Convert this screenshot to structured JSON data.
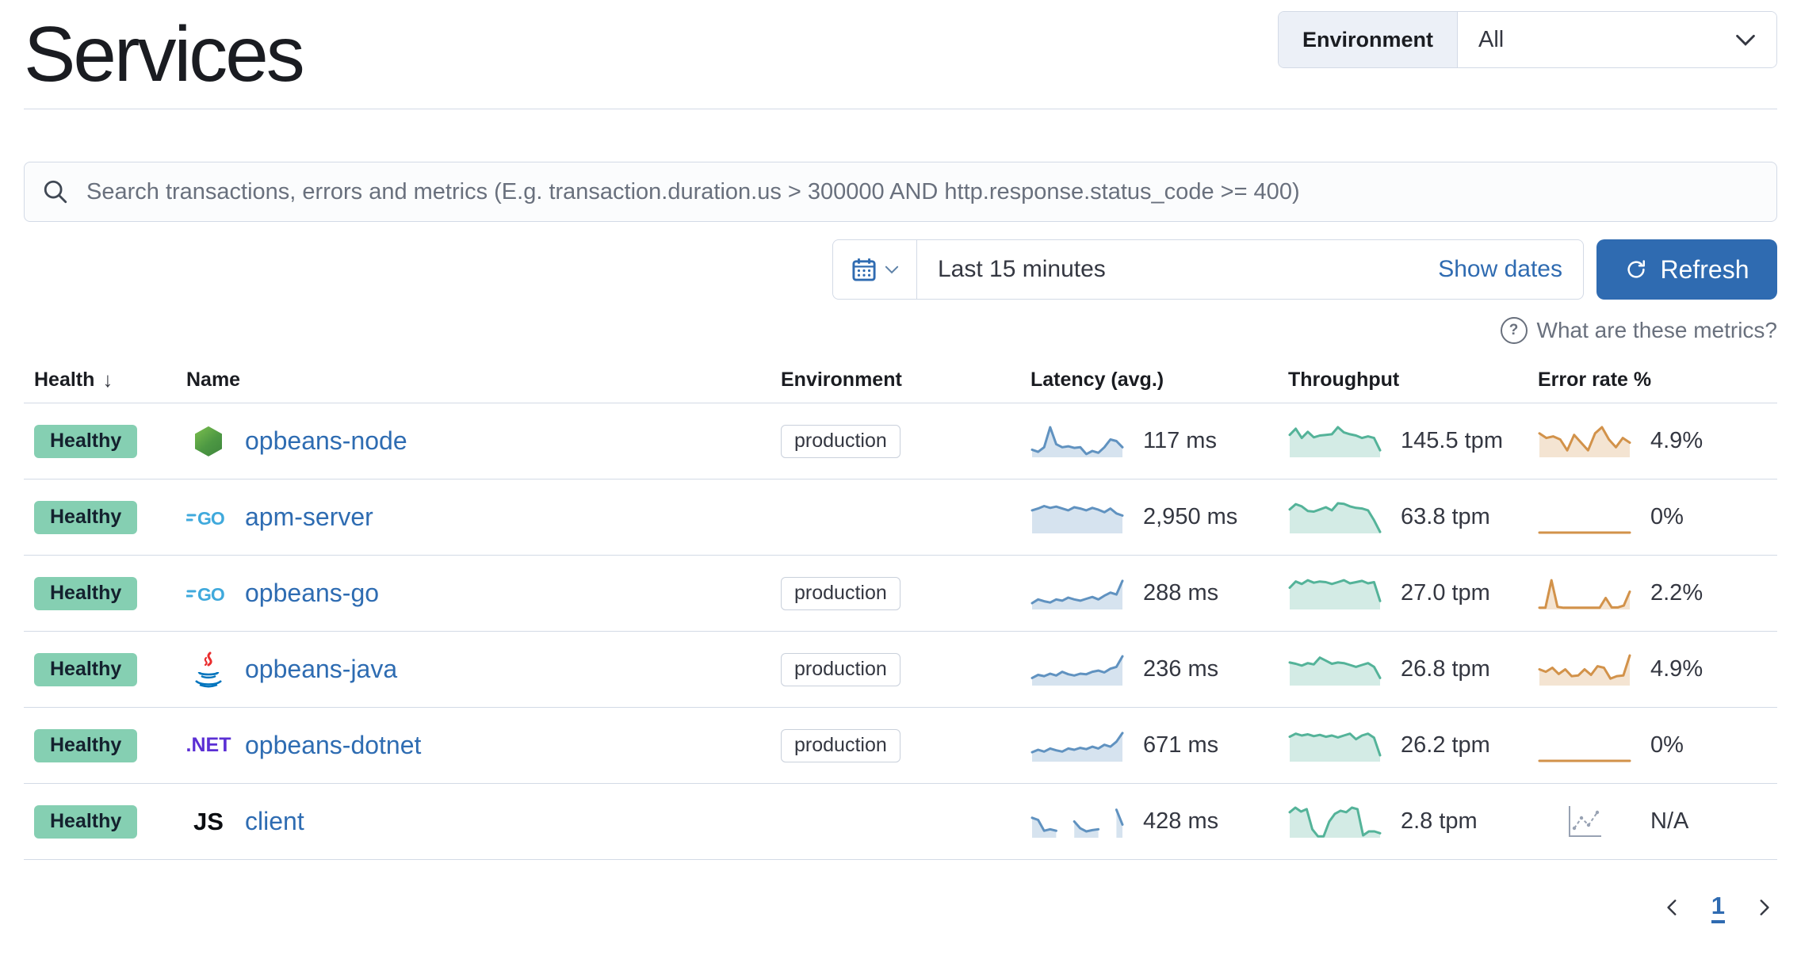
{
  "page": {
    "title": "Services"
  },
  "env_filter": {
    "label": "Environment",
    "value": "All"
  },
  "search": {
    "placeholder": "Search transactions, errors and metrics (E.g. transaction.duration.us > 300000 AND http.response.status_code >= 400)"
  },
  "time_picker": {
    "value": "Last 15 minutes",
    "show_dates_label": "Show dates",
    "refresh_label": "Refresh"
  },
  "metrics_help": {
    "label": "What are these metrics?"
  },
  "table": {
    "columns": [
      "Health",
      "Name",
      "Environment",
      "Latency (avg.)",
      "Throughput",
      "Error rate %"
    ],
    "sorted_column": "Health",
    "agent_icon_labels": {
      "go": "GO",
      "dotnet": ".NET",
      "js": "JS"
    },
    "rows": [
      {
        "health": "Healthy",
        "name": "opbeans-node",
        "agent": "nodejs",
        "environment": "production",
        "latency": {
          "value": "117 ms",
          "points": [
            0.22,
            0.15,
            0.3,
            0.95,
            0.4,
            0.3,
            0.33,
            0.28,
            0.3,
            0.08,
            0.18,
            0.12,
            0.3,
            0.55,
            0.5,
            0.3
          ]
        },
        "throughput": {
          "value": "145.5 tpm",
          "points": [
            0.7,
            0.9,
            0.6,
            0.8,
            0.62,
            0.68,
            0.7,
            0.72,
            0.95,
            0.78,
            0.72,
            0.68,
            0.6,
            0.65,
            0.6,
            0.2
          ]
        },
        "error_rate": {
          "value": "4.9%",
          "points": [
            0.75,
            0.6,
            0.65,
            0.55,
            0.2,
            0.7,
            0.45,
            0.2,
            0.75,
            0.95,
            0.55,
            0.3,
            0.6,
            0.45
          ]
        }
      },
      {
        "health": "Healthy",
        "name": "apm-server",
        "agent": "go",
        "environment": "",
        "latency": {
          "value": "2,950 ms",
          "points": [
            0.72,
            0.78,
            0.86,
            0.8,
            0.84,
            0.78,
            0.72,
            0.82,
            0.78,
            0.72,
            0.8,
            0.74,
            0.66,
            0.78,
            0.62,
            0.55
          ]
        },
        "throughput": {
          "value": "63.8 tpm",
          "points": [
            0.75,
            0.92,
            0.85,
            0.7,
            0.68,
            0.75,
            0.82,
            0.72,
            0.95,
            0.93,
            0.85,
            0.8,
            0.78,
            0.72,
            0.4,
            0.02
          ]
        },
        "error_rate": {
          "value": "0%",
          "points": [
            0,
            0,
            0,
            0,
            0,
            0,
            0,
            0,
            0,
            0,
            0,
            0,
            0,
            0,
            0,
            0
          ]
        }
      },
      {
        "health": "Healthy",
        "name": "opbeans-go",
        "agent": "go",
        "environment": "production",
        "latency": {
          "value": "288 ms",
          "points": [
            0.18,
            0.3,
            0.24,
            0.2,
            0.3,
            0.26,
            0.36,
            0.3,
            0.26,
            0.32,
            0.38,
            0.3,
            0.42,
            0.52,
            0.46,
            0.9
          ]
        },
        "throughput": {
          "value": "27.0 tpm",
          "points": [
            0.68,
            0.88,
            0.8,
            0.92,
            0.84,
            0.88,
            0.86,
            0.8,
            0.86,
            0.92,
            0.82,
            0.86,
            0.9,
            0.82,
            0.86,
            0.25
          ]
        },
        "error_rate": {
          "value": "2.2%",
          "points": [
            0.03,
            0.03,
            0.92,
            0.06,
            0.03,
            0.03,
            0.03,
            0.03,
            0.03,
            0.03,
            0.03,
            0.35,
            0.04,
            0.04,
            0.1,
            0.55
          ]
        }
      },
      {
        "health": "Healthy",
        "name": "opbeans-java",
        "agent": "java",
        "environment": "production",
        "latency": {
          "value": "236 ms",
          "points": [
            0.22,
            0.32,
            0.28,
            0.36,
            0.3,
            0.42,
            0.34,
            0.3,
            0.36,
            0.34,
            0.42,
            0.46,
            0.4,
            0.52,
            0.58,
            0.92
          ]
        },
        "throughput": {
          "value": "26.8 tpm",
          "points": [
            0.72,
            0.68,
            0.62,
            0.7,
            0.66,
            0.88,
            0.78,
            0.68,
            0.72,
            0.7,
            0.64,
            0.58,
            0.64,
            0.7,
            0.58,
            0.22
          ]
        },
        "error_rate": {
          "value": "4.9%",
          "points": [
            0.5,
            0.42,
            0.55,
            0.35,
            0.5,
            0.28,
            0.3,
            0.5,
            0.32,
            0.6,
            0.55,
            0.2,
            0.28,
            0.3,
            0.95
          ]
        }
      },
      {
        "health": "Healthy",
        "name": "opbeans-dotnet",
        "agent": "dotnet",
        "environment": "production",
        "latency": {
          "value": "671 ms",
          "points": [
            0.28,
            0.36,
            0.3,
            0.4,
            0.34,
            0.3,
            0.4,
            0.36,
            0.42,
            0.38,
            0.46,
            0.4,
            0.52,
            0.46,
            0.62,
            0.9
          ]
        },
        "throughput": {
          "value": "26.2 tpm",
          "points": [
            0.78,
            0.88,
            0.82,
            0.86,
            0.8,
            0.84,
            0.78,
            0.82,
            0.76,
            0.82,
            0.88,
            0.7,
            0.82,
            0.88,
            0.75,
            0.18
          ]
        },
        "error_rate": {
          "value": "0%",
          "points": [
            0,
            0,
            0,
            0,
            0,
            0,
            0,
            0,
            0,
            0,
            0,
            0,
            0,
            0,
            0,
            0
          ]
        }
      },
      {
        "health": "Healthy",
        "name": "client",
        "agent": "js",
        "environment": "",
        "latency": {
          "value": "428 ms",
          "points": [
            0.62,
            0.55,
            0.2,
            0.25,
            0.2,
            null,
            null,
            0.5,
            0.28,
            0.18,
            0.22,
            0.25,
            null,
            null,
            0.88,
            0.4
          ]
        },
        "throughput": {
          "value": "2.8 tpm",
          "points": [
            0.8,
            0.95,
            0.82,
            0.9,
            0.25,
            0.02,
            0.02,
            0.5,
            0.75,
            0.85,
            0.8,
            0.95,
            0.9,
            0.05,
            0.18,
            0.18,
            0.12
          ]
        },
        "error_rate": {
          "value": "N/A",
          "points": null
        }
      }
    ]
  },
  "pagination": {
    "current": "1"
  },
  "colors": {
    "primary": "#2F6BB1",
    "link": "#2E6CB2",
    "healthy_badge": "#85CFB2",
    "latency_line": "#6092C0",
    "latency_fill": "rgba(96,146,192,0.26)",
    "throughput_line": "#54B399",
    "throughput_fill": "rgba(84,179,153,0.26)",
    "error_line": "#D2924A",
    "error_fill": "rgba(210,146,74,0.25)",
    "divider": "#D3DAE6",
    "subdued_text": "#69707D"
  }
}
